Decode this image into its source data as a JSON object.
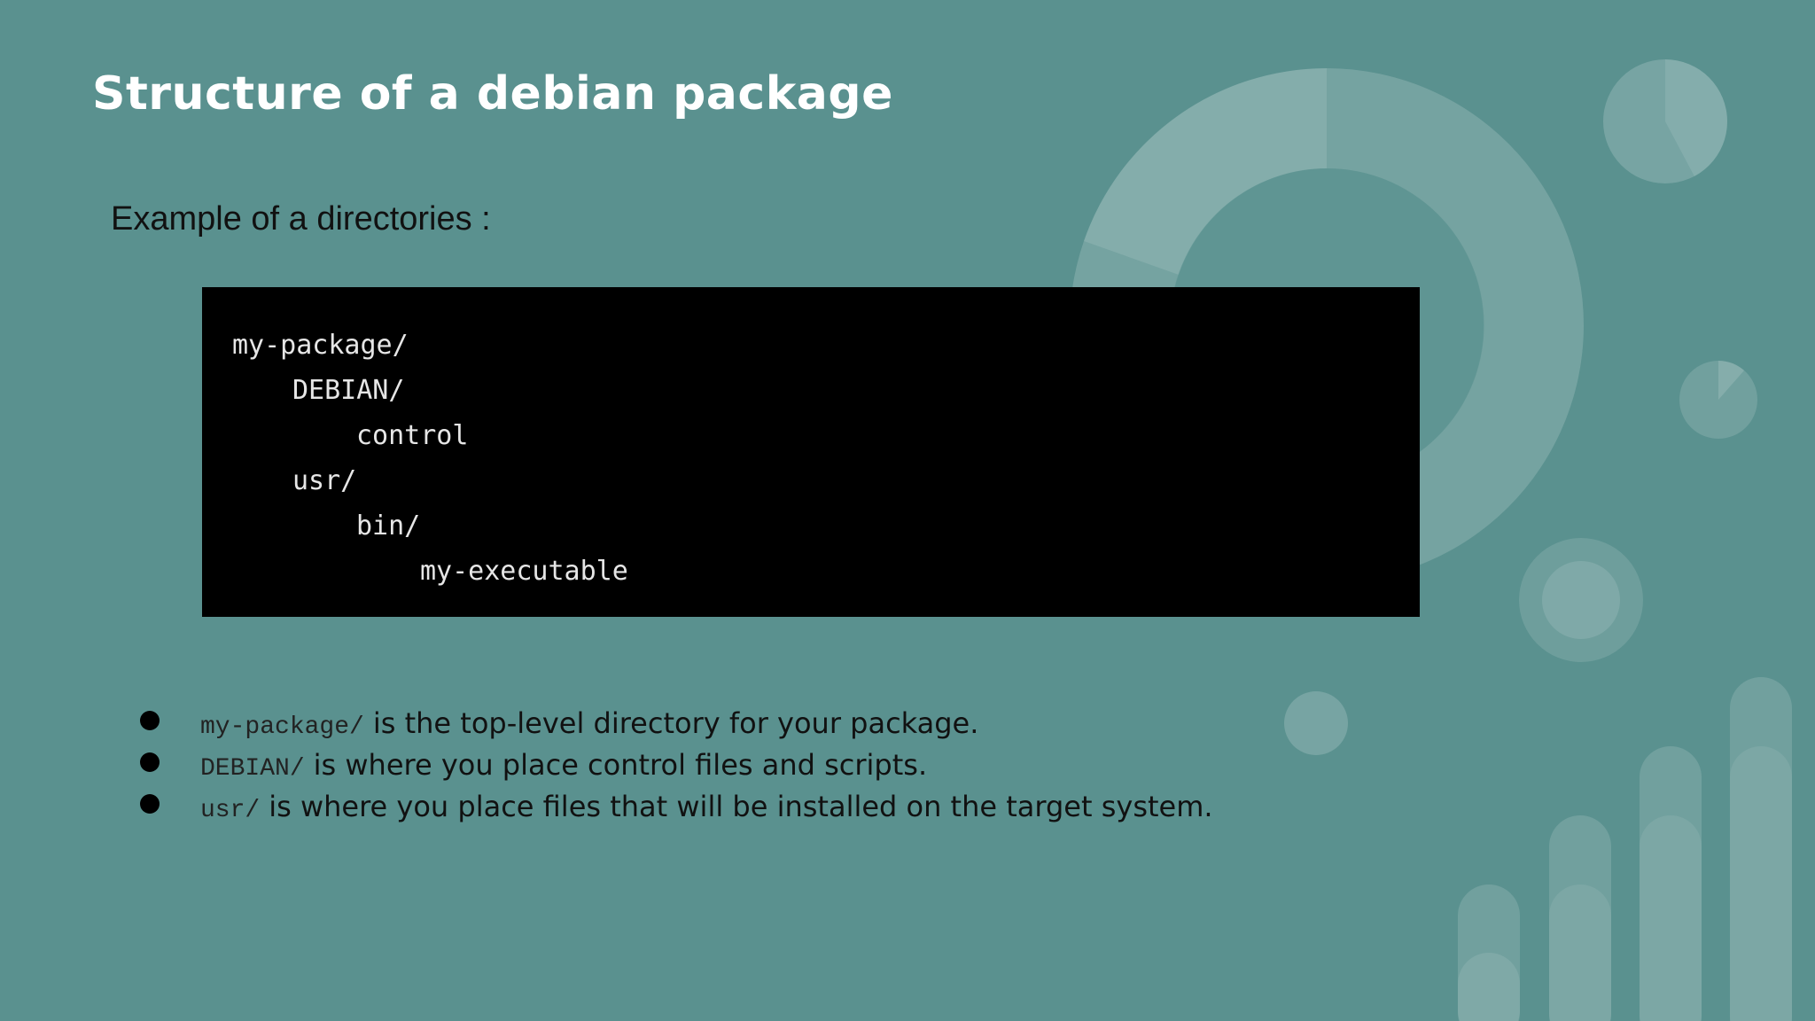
{
  "slide": {
    "title": "Structure of a debian package",
    "subtitle": "Example of a directories :"
  },
  "code": {
    "lines": [
      {
        "text": "my-package/",
        "indent": 0
      },
      {
        "text": "DEBIAN/",
        "indent": 1
      },
      {
        "text": "control",
        "indent": 2
      },
      {
        "text": "usr/",
        "indent": 1
      },
      {
        "text": "bin/",
        "indent": 2
      },
      {
        "text": "my-executable",
        "indent": 3
      }
    ]
  },
  "bullets": [
    {
      "code": "my-package/",
      "text": "is the top-level directory for your package."
    },
    {
      "code": "DEBIAN/",
      "text": "is where you place control files and scripts."
    },
    {
      "code": "usr/",
      "text": "is where you place files that will be installed on the target system."
    }
  ],
  "colors": {
    "background": "#5a918f",
    "title": "#ffffff",
    "code_background": "#000000",
    "code_text": "#e6e6e6"
  }
}
